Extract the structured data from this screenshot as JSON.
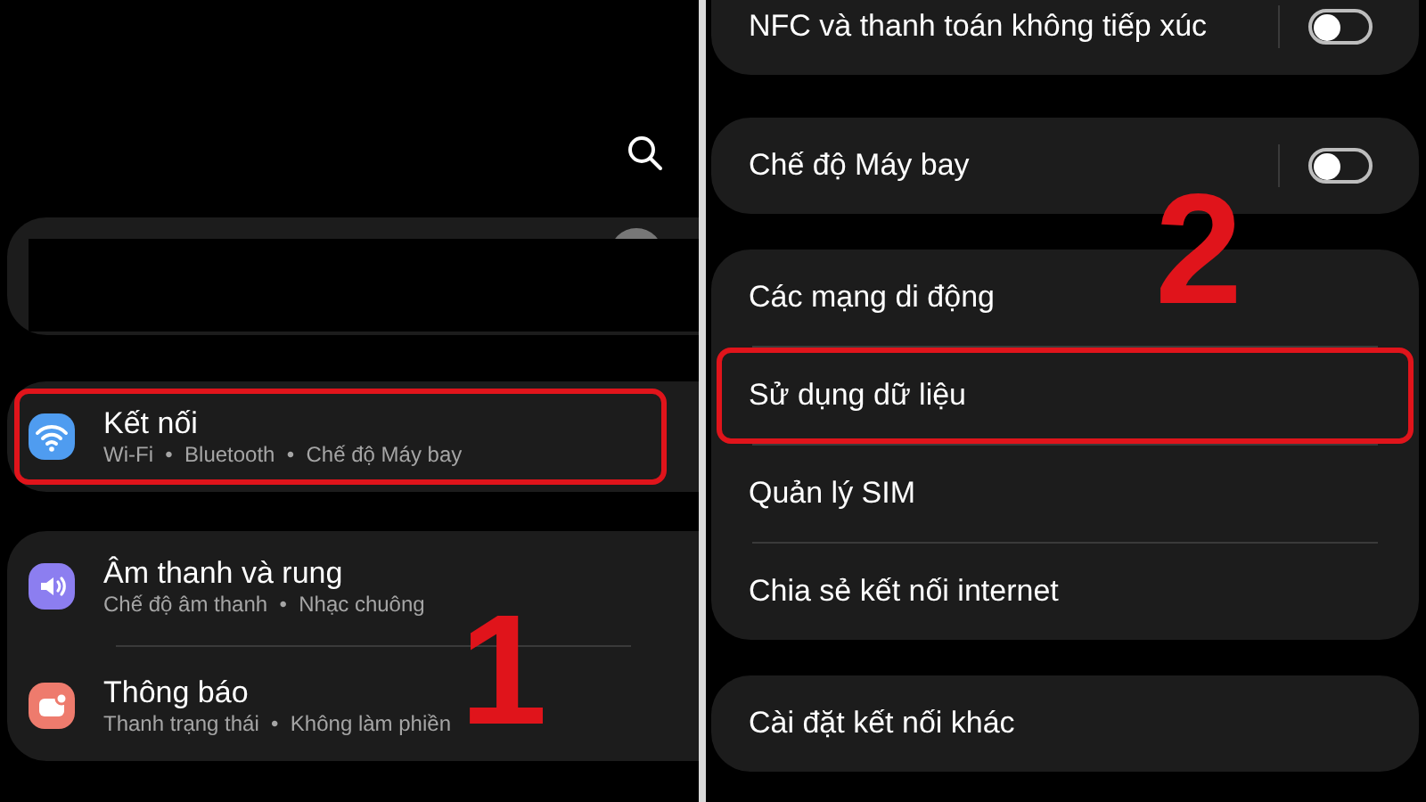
{
  "left_screen": {
    "step_number": "1",
    "groups": [
      {
        "items": [
          {
            "title": "Kết nối",
            "subtitle": "Wi-Fi  •  Bluetooth  •  Chế độ Máy bay",
            "kind": "wifi",
            "highlighted": true
          }
        ]
      },
      {
        "items": [
          {
            "title": "Âm thanh và rung",
            "subtitle": "Chế độ âm thanh  •  Nhạc chuông",
            "kind": "sound",
            "highlighted": false
          },
          {
            "title": "Thông báo",
            "subtitle": "Thanh trạng thái  •  Không làm phiền",
            "kind": "notification",
            "highlighted": false
          }
        ]
      }
    ]
  },
  "right_screen": {
    "step_number": "2",
    "groups": [
      {
        "items": [
          {
            "title": "NFC và thanh toán không tiếp xúc",
            "kind": "toggle",
            "on": false,
            "highlighted": false
          }
        ]
      },
      {
        "items": [
          {
            "title": "Chế độ Máy bay",
            "kind": "toggle",
            "on": false,
            "highlighted": false
          }
        ]
      },
      {
        "items": [
          {
            "title": "Các mạng di động",
            "kind": "link",
            "highlighted": false
          },
          {
            "title": "Sử dụng dữ liệu",
            "kind": "link",
            "highlighted": true
          },
          {
            "title": "Quản lý SIM",
            "kind": "link",
            "highlighted": false
          },
          {
            "title": "Chia sẻ kết nối internet",
            "kind": "link",
            "highlighted": false
          }
        ]
      },
      {
        "items": [
          {
            "title": "Cài đặt kết nối khác",
            "kind": "link",
            "highlighted": false
          }
        ]
      }
    ]
  }
}
